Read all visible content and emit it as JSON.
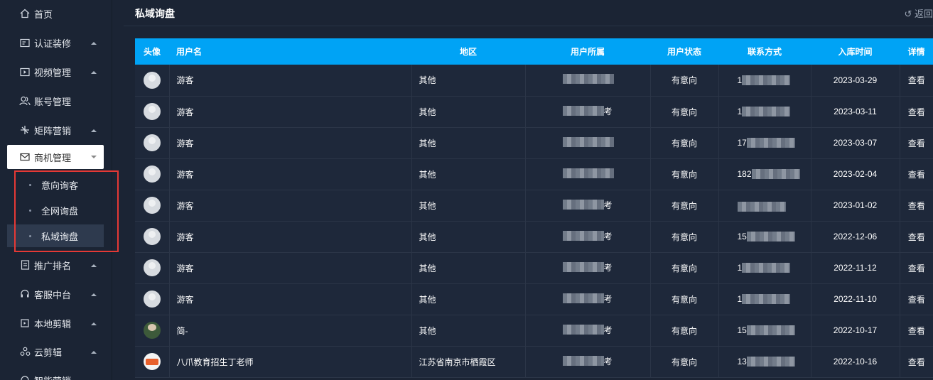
{
  "sidebar": {
    "items": [
      {
        "label": "首页",
        "icon": "home-icon"
      },
      {
        "label": "认证装修",
        "icon": "certificate-icon"
      },
      {
        "label": "视频管理",
        "icon": "video-icon"
      },
      {
        "label": "账号管理",
        "icon": "users-icon"
      },
      {
        "label": "矩阵营销",
        "icon": "matrix-icon"
      },
      {
        "label": "商机管理",
        "icon": "mail-icon"
      },
      {
        "label": "推广排名",
        "icon": "ranking-icon"
      },
      {
        "label": "客服中台",
        "icon": "headset-icon"
      },
      {
        "label": "本地剪辑",
        "icon": "clip-icon"
      },
      {
        "label": "云剪辑",
        "icon": "cloud-clip-icon"
      },
      {
        "label": "智能营销",
        "icon": "smart-icon"
      }
    ],
    "subitems": [
      {
        "label": "意向询客"
      },
      {
        "label": "全网询盘"
      },
      {
        "label": "私域询盘"
      }
    ]
  },
  "header": {
    "title": "私域询盘",
    "back_label": "↺ 返回"
  },
  "table": {
    "columns": [
      "头像",
      "用户名",
      "地区",
      "用户所属",
      "用户状态",
      "联系方式",
      "入库时间",
      "详情"
    ],
    "rows": [
      {
        "avatar": "guest",
        "username": "游客",
        "region": "其他",
        "owner_suffix": "",
        "status": "有意向",
        "contact_prefix": "1",
        "date": "2023-03-29",
        "action": "查看"
      },
      {
        "avatar": "guest",
        "username": "游客",
        "region": "其他",
        "owner_suffix": "考",
        "status": "有意向",
        "contact_prefix": "1",
        "date": "2023-03-11",
        "action": "查看"
      },
      {
        "avatar": "guest",
        "username": "游客",
        "region": "其他",
        "owner_suffix": "",
        "status": "有意向",
        "contact_prefix": "17",
        "date": "2023-03-07",
        "action": "查看"
      },
      {
        "avatar": "guest",
        "username": "游客",
        "region": "其他",
        "owner_suffix": "",
        "status": "有意向",
        "contact_prefix": "182",
        "date": "2023-02-04",
        "action": "查看"
      },
      {
        "avatar": "guest",
        "username": "游客",
        "region": "其他",
        "owner_suffix": "考",
        "status": "有意向",
        "contact_prefix": "",
        "date": "2023-01-02",
        "action": "查看"
      },
      {
        "avatar": "guest",
        "username": "游客",
        "region": "其他",
        "owner_suffix": "考",
        "status": "有意向",
        "contact_prefix": "15",
        "date": "2022-12-06",
        "action": "查看"
      },
      {
        "avatar": "guest",
        "username": "游客",
        "region": "其他",
        "owner_suffix": "考",
        "status": "有意向",
        "contact_prefix": "1",
        "date": "2022-11-12",
        "action": "查看"
      },
      {
        "avatar": "guest",
        "username": "游客",
        "region": "其他",
        "owner_suffix": "考",
        "status": "有意向",
        "contact_prefix": "1",
        "date": "2022-11-10",
        "action": "查看"
      },
      {
        "avatar": "photo",
        "username": "简-",
        "region": "其他",
        "owner_suffix": "考",
        "status": "有意向",
        "contact_prefix": "15",
        "date": "2022-10-17",
        "action": "查看"
      },
      {
        "avatar": "logo",
        "username": "八爪教育招生丁老师",
        "region": "江苏省南京市栖霞区",
        "owner_suffix": "考",
        "status": "有意向",
        "contact_prefix": "13",
        "date": "2022-10-16",
        "action": "查看"
      }
    ]
  },
  "colors": {
    "background": "#1b2434",
    "header_bar": "#00a3f5",
    "highlight": "#e53935"
  }
}
